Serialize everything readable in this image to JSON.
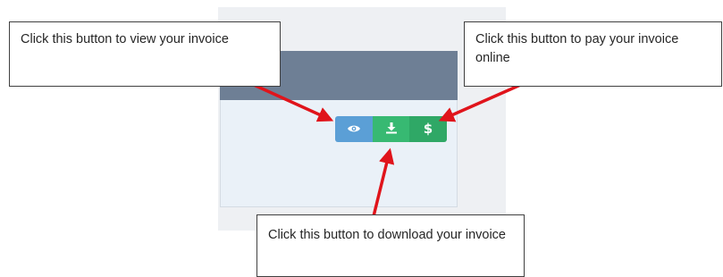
{
  "callouts": {
    "view": "Click this button to view your invoice",
    "pay": "Click this button to pay your invoice online",
    "download": "Click this button to download your invoice"
  },
  "buttons": {
    "view": {
      "icon": "eye-icon"
    },
    "download": {
      "icon": "download-icon"
    },
    "pay": {
      "icon": "dollar-icon",
      "label": "$"
    }
  },
  "colors": {
    "view_button": "#5b9fd6",
    "download_button": "#37b972",
    "pay_button": "#2fa866",
    "panel_header": "#6e7f95",
    "panel_body": "#eaf1f8",
    "arrow": "#e0141b"
  }
}
